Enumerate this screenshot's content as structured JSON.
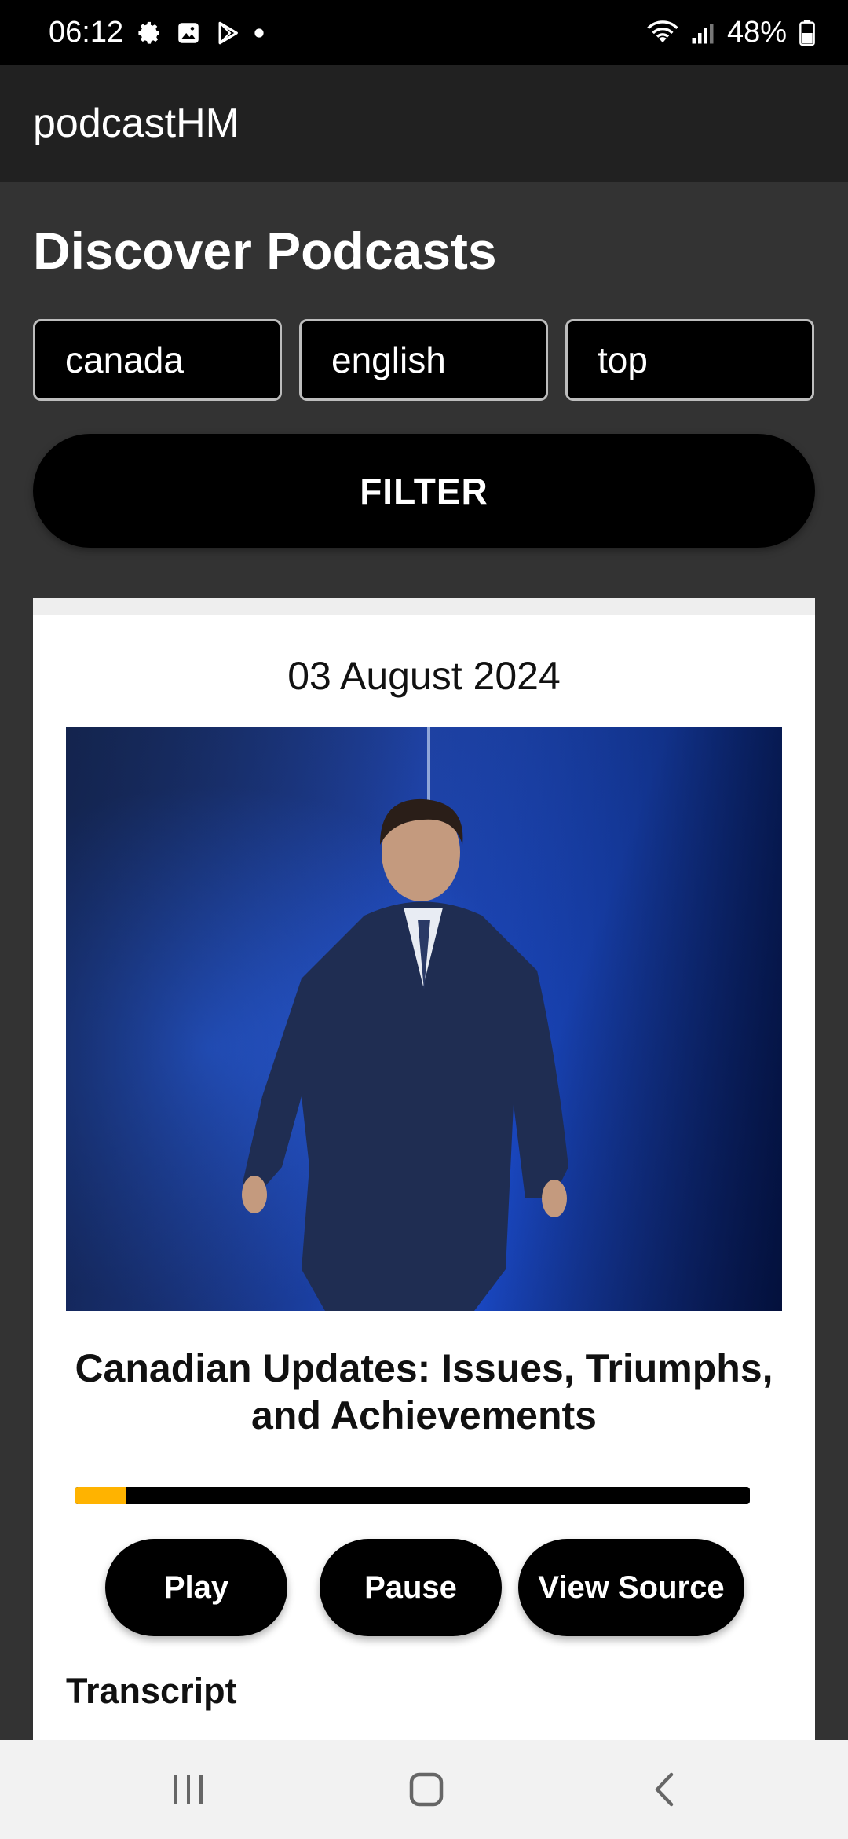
{
  "status_bar": {
    "time": "06:12",
    "battery": "48%",
    "icons": [
      "settings-icon",
      "gallery-icon",
      "play-store-icon",
      "dot-icon",
      "wifi-icon",
      "signal-icon",
      "battery-icon"
    ]
  },
  "app_bar": {
    "title": "podcastHM"
  },
  "main": {
    "title": "Discover Podcasts",
    "filters": {
      "country": "canada",
      "language": "english",
      "category": "top"
    },
    "filter_button": "FILTER"
  },
  "card": {
    "date": "03 August 2024",
    "title": "Canadian Updates: Issues, Triumphs, and Achievements",
    "progress_fraction": 0.075,
    "buttons": {
      "play": "Play",
      "pause": "Pause",
      "view_source": "View Source"
    },
    "transcript_heading": "Transcript"
  },
  "nav_bar": {
    "icons": [
      "recent-apps-icon",
      "home-icon",
      "back-icon"
    ]
  },
  "colors": {
    "accent": "#ffb300",
    "background": "#333333",
    "app_bar": "#212121"
  }
}
